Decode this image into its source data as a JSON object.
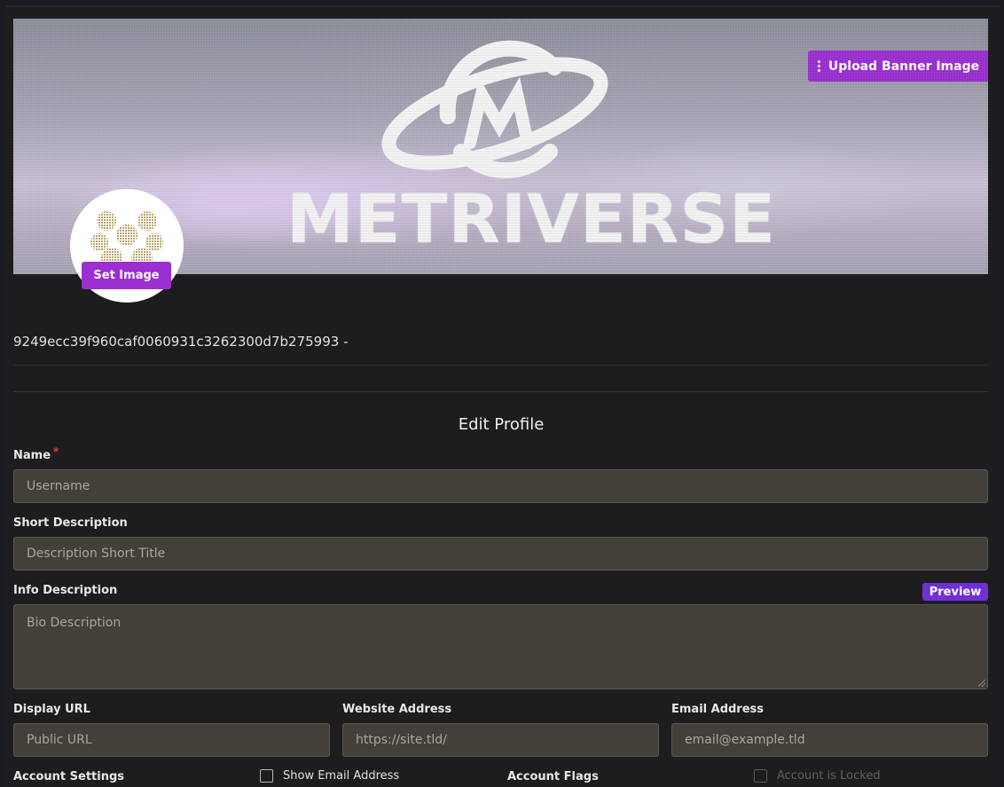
{
  "banner": {
    "wordmark": "METRIVERSE",
    "upload_label": "Upload Banner Image"
  },
  "avatar": {
    "set_image_label": "Set Image"
  },
  "profile": {
    "id_line": "9249ecc39f960caf0060931c3262300d7b275993 -"
  },
  "form": {
    "title": "Edit Profile",
    "name": {
      "label": "Name",
      "required_mark": "*",
      "placeholder": "Username",
      "value": ""
    },
    "short_description": {
      "label": "Short Description",
      "placeholder": "Description Short Title",
      "value": ""
    },
    "info_description": {
      "label": "Info Description",
      "placeholder": "Bio Description",
      "value": "",
      "preview_label": "Preview"
    },
    "display_url": {
      "label": "Display URL",
      "placeholder": "Public URL",
      "value": ""
    },
    "website_address": {
      "label": "Website Address",
      "placeholder": "https://site.tld/",
      "value": ""
    },
    "email_address": {
      "label": "Email Address",
      "placeholder": "email@example.tld",
      "value": ""
    },
    "account_settings": {
      "label": "Account Settings",
      "show_email_label": "Show Email Address",
      "show_email_checked": false
    },
    "account_flags": {
      "label": "Account Flags",
      "locked_label": "Account is Locked",
      "locked_checked": false,
      "locked_disabled": true
    }
  },
  "colors": {
    "accent": "#9b2fd1",
    "preview_accent": "#6e2fd6",
    "field_bg": "#434039",
    "page_bg": "#1d1d20",
    "required": "#e03c3c"
  }
}
